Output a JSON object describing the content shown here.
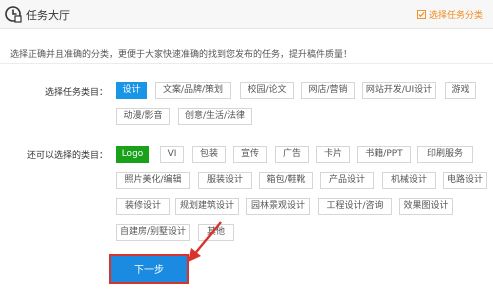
{
  "header": {
    "title": "任务大厅",
    "select_category": "选择任务分类"
  },
  "tip": "选择正确并且准确的分类，更便于大家快速准确的找到您发布的任务，提升稿件质量！",
  "main_category": {
    "label": "选择任务类目：",
    "items": [
      "设计",
      "文案/品牌/策划",
      "校园/论文",
      "网店/营销",
      "网站开发/UI设计",
      "游戏",
      "动漫/影音",
      "创意/生活/法律"
    ],
    "selected": "设计"
  },
  "sub_category": {
    "label": "还可以选择的类目：",
    "items": [
      "Logo",
      "VI",
      "包装",
      "宣传",
      "广告",
      "卡片",
      "书籍/PPT",
      "印刷服务",
      "照片美化/编辑",
      "服装设计",
      "箱包/鞋靴",
      "产品设计",
      "机械设计",
      "电路设计",
      "装修设计",
      "规划建筑设计",
      "园林景观设计",
      "工程设计/咨询",
      "效果图设计",
      "自建房/别墅设计",
      "其他"
    ],
    "selected": "Logo"
  },
  "next_button": "下一步",
  "colors": {
    "accent_blue": "#1a95e6",
    "accent_green": "#1aa11a",
    "accent_orange": "#f08b1d",
    "highlight_red": "#d9342b"
  }
}
